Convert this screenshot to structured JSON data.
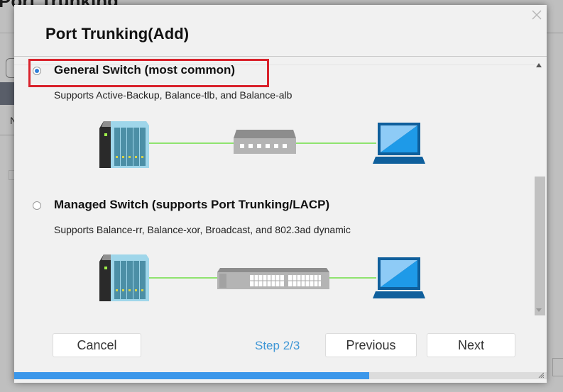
{
  "background": {
    "page_title": "Port Trunking",
    "column_initial": "N"
  },
  "dialog": {
    "title": "Port Trunking(Add)",
    "close_icon": "close-icon",
    "options": [
      {
        "label": "General Switch (most common)",
        "description": "Supports Active-Backup, Balance-tlb, and Balance-alb",
        "selected": true,
        "highlighted": true,
        "diagram": [
          "nas-icon",
          "unmanaged-switch-icon",
          "laptop-icon"
        ]
      },
      {
        "label": "Managed Switch (supports Port Trunking/LACP)",
        "description": "Supports Balance-rr, Balance-xor, Broadcast, and 802.3ad dynamic",
        "selected": false,
        "highlighted": false,
        "diagram": [
          "nas-icon",
          "managed-switch-icon",
          "laptop-icon"
        ]
      }
    ],
    "footer": {
      "cancel_label": "Cancel",
      "step_label": "Step 2/3",
      "previous_label": "Previous",
      "next_label": "Next"
    },
    "progress_percent": 66.7
  },
  "colors": {
    "accent": "#3b97ea",
    "step_text": "#3f97d6",
    "highlight_border": "#d9222c",
    "link_line": "#8fe36f"
  }
}
